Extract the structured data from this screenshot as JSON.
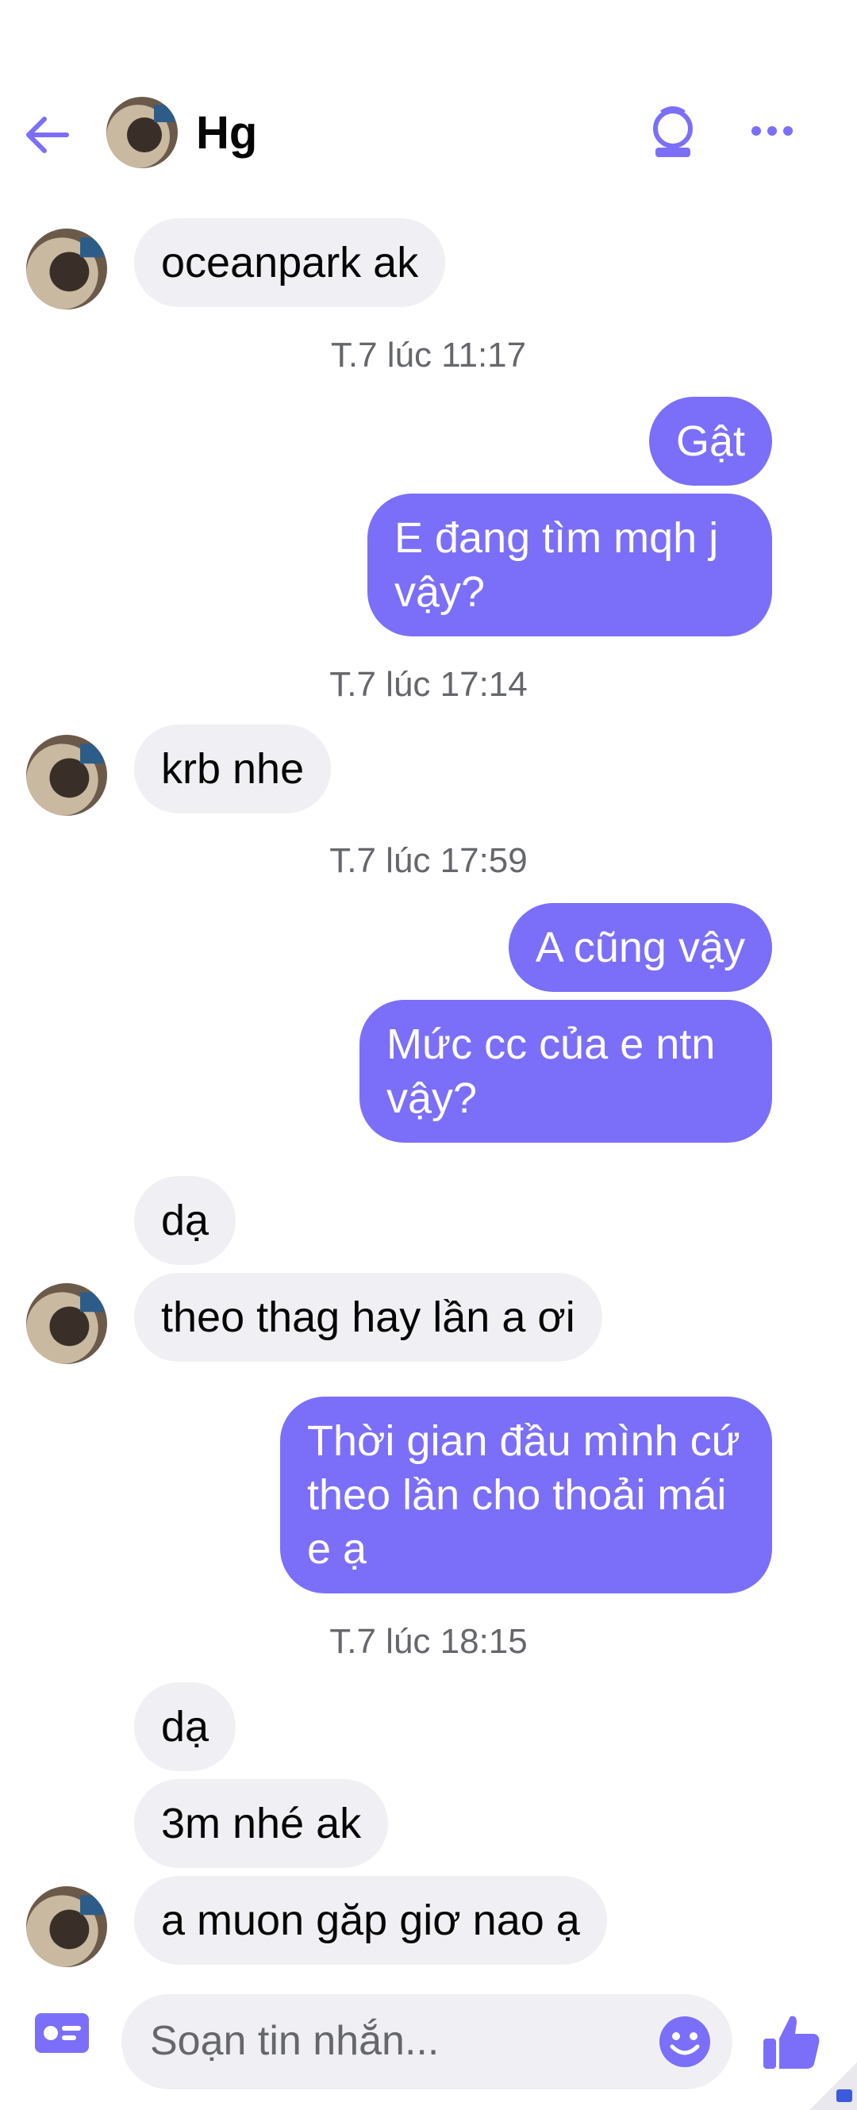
{
  "header": {
    "contact_name": "Hg",
    "back_icon": "arrow-left-icon",
    "call_icon": "video-call-icon",
    "more_icon": "more-dots-icon"
  },
  "colors": {
    "accent": "#7b6ff9",
    "incoming_bubble": "#f0f0f4",
    "timestamp": "#65676b"
  },
  "messages": [
    {
      "sender": "them",
      "text": "oceanpark ak"
    },
    {
      "timestamp": "T.7 lúc 11:17"
    },
    {
      "sender": "me",
      "text": "Gật"
    },
    {
      "sender": "me",
      "text": "E đang tìm mqh j vậy?"
    },
    {
      "timestamp": "T.7 lúc 17:14"
    },
    {
      "sender": "them",
      "text": "krb nhe"
    },
    {
      "timestamp": "T.7 lúc 17:59"
    },
    {
      "sender": "me",
      "text": "A cũng vậy"
    },
    {
      "sender": "me",
      "text": "Mức cc của e ntn vậy?"
    },
    {
      "sender": "them",
      "text": "dạ"
    },
    {
      "sender": "them",
      "text": "theo thag hay lần a ơi"
    },
    {
      "sender": "me",
      "text": "Thời gian đầu mình cứ theo lần cho thoải mái e ạ"
    },
    {
      "timestamp": "T.7 lúc 18:15"
    },
    {
      "sender": "them",
      "text": "dạ"
    },
    {
      "sender": "them",
      "text": "3m nhé ak"
    },
    {
      "sender": "them",
      "text": "a muon găp giơ nao ạ"
    }
  ],
  "composer": {
    "placeholder": "Soạn tin nhắn...",
    "left_icon": "contact-card-icon",
    "emoji_icon": "emoji-icon",
    "like_icon": "thumbs-up-icon"
  }
}
